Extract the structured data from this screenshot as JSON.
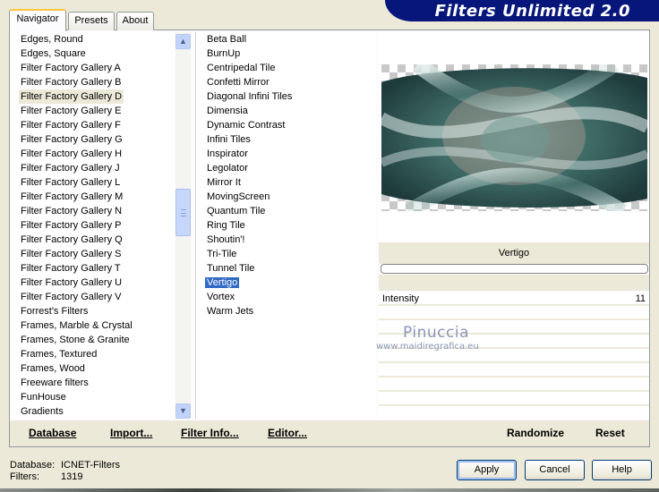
{
  "header": {
    "title": "Filters Unlimited 2.0"
  },
  "tabs": [
    {
      "label": "Navigator",
      "active": true
    },
    {
      "label": "Presets",
      "active": false
    },
    {
      "label": "About",
      "active": false
    }
  ],
  "categories": {
    "items": [
      "Edges, Round",
      "Edges, Square",
      "Filter Factory Gallery A",
      "Filter Factory Gallery B",
      "Filter Factory Gallery D",
      "Filter Factory Gallery E",
      "Filter Factory Gallery F",
      "Filter Factory Gallery G",
      "Filter Factory Gallery H",
      "Filter Factory Gallery J",
      "Filter Factory Gallery L",
      "Filter Factory Gallery M",
      "Filter Factory Gallery N",
      "Filter Factory Gallery P",
      "Filter Factory Gallery Q",
      "Filter Factory Gallery S",
      "Filter Factory Gallery T",
      "Filter Factory Gallery U",
      "Filter Factory Gallery V",
      "Forrest's Filters",
      "Frames, Marble & Crystal",
      "Frames, Stone & Granite",
      "Frames, Textured",
      "Frames, Wood",
      "Freeware filters",
      "FunHouse",
      "Gradients"
    ],
    "selected": "Filter Factory Gallery D"
  },
  "filters": {
    "items": [
      "Beta Ball",
      "BurnUp",
      "Centripedal Tile",
      "Confetti Mirror",
      "Diagonal Infini Tiles",
      "Dimensia",
      "Dynamic Contrast",
      "Infini Tiles",
      "Inspirator",
      "Legolator",
      "Mirror It",
      "MovingScreen",
      "Quantum Tile",
      "Ring Tile",
      "Shoutin'!",
      "Tri-Tile",
      "Tunnel Tile",
      "Vertigo",
      "Vortex",
      "Warm Jets"
    ],
    "selected": "Vertigo"
  },
  "preview": {
    "filter_name": "Vertigo"
  },
  "parameters": [
    {
      "label": "Intensity",
      "value": "11"
    }
  ],
  "watermark": {
    "name": "Pinuccia",
    "url": "www.maidiregrafica.eu"
  },
  "actions": {
    "database": "Database",
    "import": "Import...",
    "filter_info": "Filter Info...",
    "editor": "Editor...",
    "randomize": "Randomize",
    "reset": "Reset"
  },
  "status": {
    "database_label": "Database:",
    "database_value": "ICNET-Filters",
    "filters_label": "Filters:",
    "filters_value": "1319"
  },
  "dialog": {
    "apply": "Apply",
    "cancel": "Cancel",
    "help": "Help"
  },
  "colors": {
    "banner": "#06167a",
    "selection": "#316ac5",
    "background": "#ece9d8"
  }
}
